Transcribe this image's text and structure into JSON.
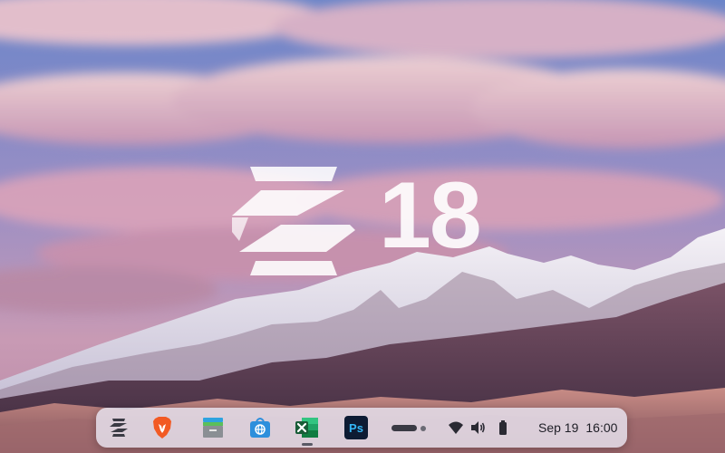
{
  "desktop": {
    "logo_name": "zorin-logo",
    "version": "18"
  },
  "taskbar": {
    "apps": [
      {
        "name": "Zorin menu",
        "icon": "zorin-menu-icon"
      },
      {
        "name": "Brave Browser",
        "icon": "brave-lion-icon"
      },
      {
        "name": "Files",
        "icon": "files-icon"
      },
      {
        "name": "Software",
        "icon": "software-store-icon"
      },
      {
        "name": "Excel",
        "icon": "excel-icon",
        "running": true
      },
      {
        "name": "Photoshop",
        "icon": "photoshop-icon",
        "label": "Ps"
      }
    ],
    "workspaces": {
      "count": 2,
      "active": 1
    },
    "tray": [
      "wifi-icon",
      "volume-icon",
      "battery-icon"
    ],
    "clock": {
      "date": "Sep 19",
      "time": "16:00"
    }
  },
  "colors": {
    "sky_top": "#6f86c6",
    "cloud": "#e8b7c3",
    "mountain_snow": "#eceaf2",
    "mountain_shadow": "#5a3f54",
    "dune": "#b07a78",
    "taskbar_bg": "#e8e4f0",
    "excel_green": "#1f7a43",
    "photoshop_bg": "#0d1b33",
    "photoshop_text": "#34b6f5",
    "brave_orange": "#f25a24"
  }
}
